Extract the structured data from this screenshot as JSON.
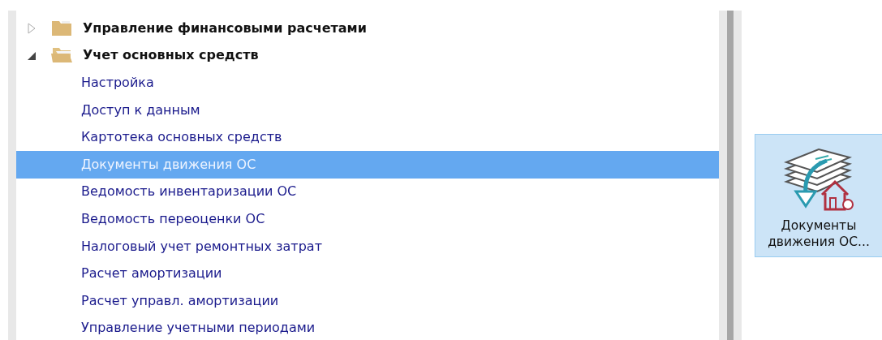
{
  "tree": [
    {
      "label": "Управление финансовыми расчетами",
      "expanded": false
    },
    {
      "label": "Учет основных средств",
      "expanded": true,
      "children": [
        {
          "label": "Настройка",
          "selected": false
        },
        {
          "label": "Доступ к данным",
          "selected": false
        },
        {
          "label": "Картотека основных средств",
          "selected": false
        },
        {
          "label": "Документы движения ОС",
          "selected": true
        },
        {
          "label": "Ведомость инвентаризации ОС",
          "selected": false
        },
        {
          "label": "Ведомость переоценки ОС",
          "selected": false
        },
        {
          "label": "Налоговый учет ремонтных затрат",
          "selected": false
        },
        {
          "label": "Расчет амортизации",
          "selected": false
        },
        {
          "label": "Расчет управл. амортизации",
          "selected": false
        },
        {
          "label": "Управление учетными периодами",
          "selected": false
        }
      ]
    }
  ],
  "tiles": [
    {
      "label": "Документы движения ОС...",
      "selected": true
    }
  ]
}
